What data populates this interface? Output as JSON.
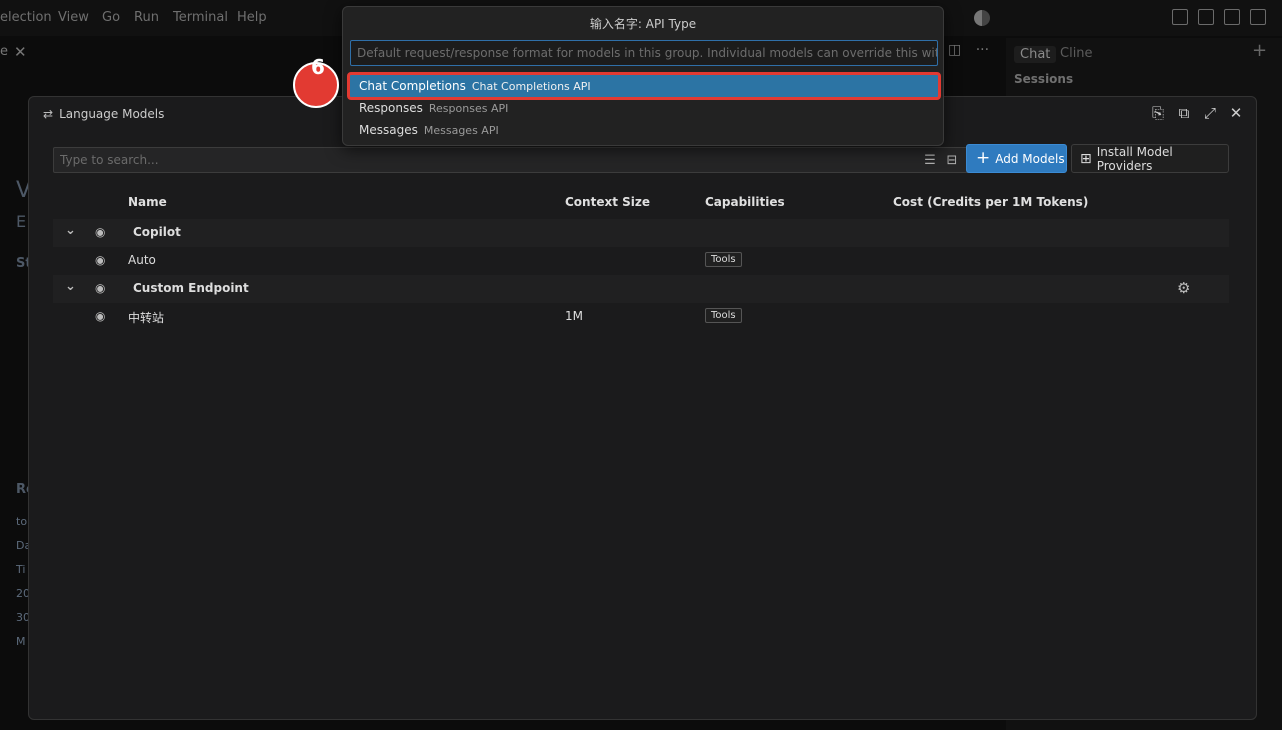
{
  "menubar": {
    "items": [
      "election",
      "View",
      "Go",
      "Run",
      "Terminal",
      "Help"
    ]
  },
  "editor": {
    "tab_fragment": "e"
  },
  "side_panel": {
    "tabs": [
      "Chat",
      "Cline"
    ],
    "sessions_label": "Sessions",
    "plus": "+"
  },
  "background_peek": {
    "left_letters": [
      "V",
      "E",
      "St",
      "Re",
      "to",
      "Da",
      "Ti",
      "20",
      "30",
      "M"
    ]
  },
  "lm_dialog": {
    "title": "Language Models",
    "search_placeholder": "Type to search...",
    "add_models_label": "Add Models",
    "install_providers_label": "Install Model Providers",
    "columns": [
      "Name",
      "Context Size",
      "Capabilities",
      "Cost (Credits per 1M Tokens)"
    ],
    "groups": [
      {
        "name": "Copilot",
        "models": [
          {
            "name": "Auto",
            "context": "",
            "capability": "Tools"
          }
        ]
      },
      {
        "name": "Custom Endpoint",
        "models": [
          {
            "name": "中转站",
            "context": "1M",
            "capability": "Tools"
          }
        ]
      }
    ]
  },
  "quick_pick": {
    "title": "输入名字: API Type",
    "placeholder": "Default request/response format for models in this group. Individual models can override this with th",
    "items": [
      {
        "label": "Chat Completions",
        "description": "Chat Completions API",
        "selected": true
      },
      {
        "label": "Responses",
        "description": "Responses API",
        "selected": false
      },
      {
        "label": "Messages",
        "description": "Messages API",
        "selected": false
      }
    ]
  },
  "step_marker": {
    "number": "6",
    "color": "#e23a32"
  },
  "colors": {
    "accent": "#2f7bbf",
    "selection": "#2c74a4",
    "highlight_border": "#e23a32"
  }
}
